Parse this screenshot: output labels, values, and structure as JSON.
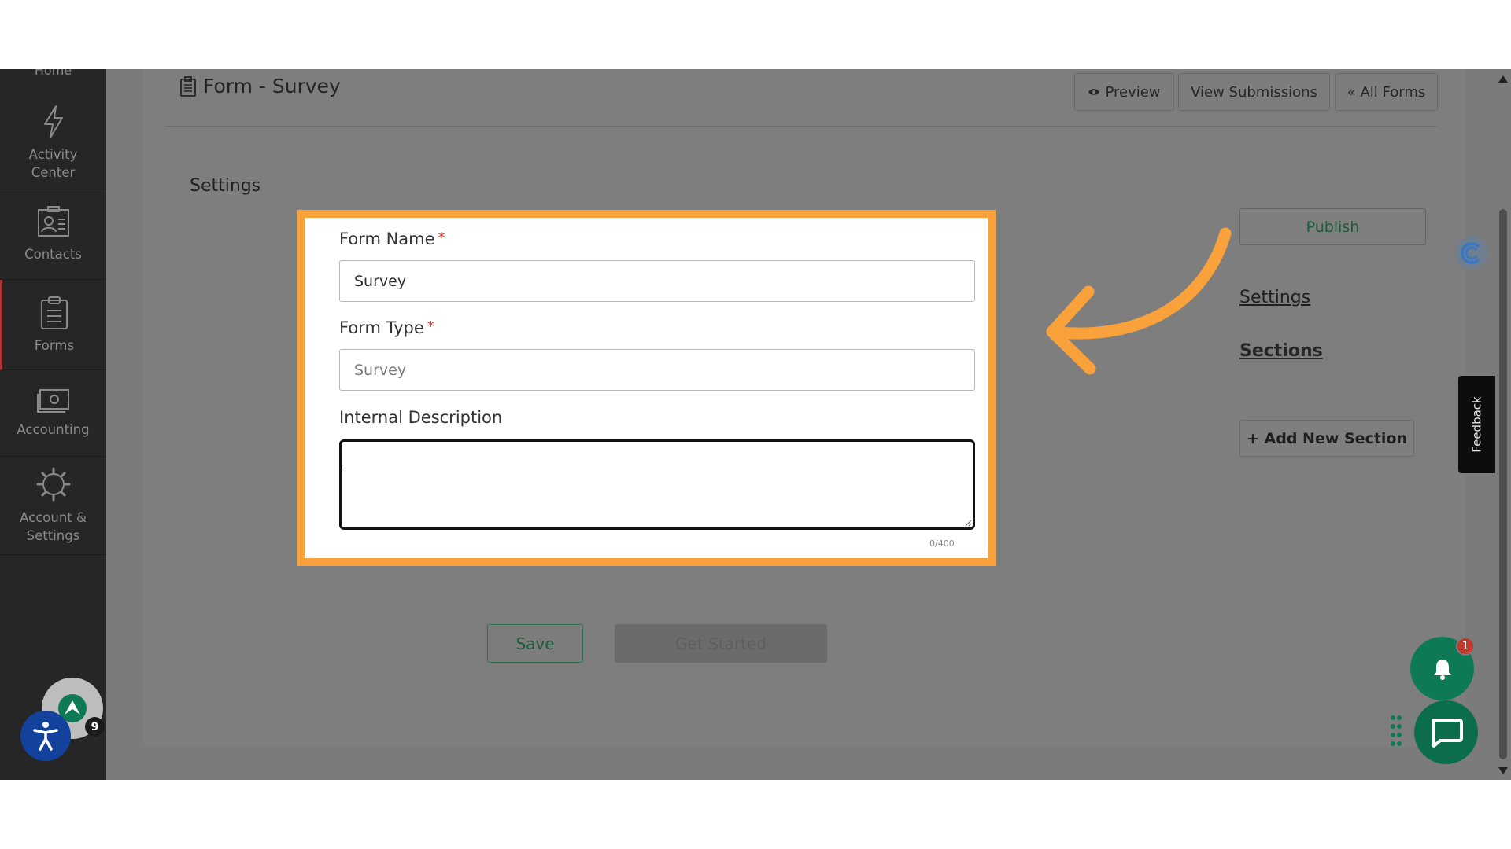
{
  "sidebar": {
    "items": [
      {
        "label": "Home",
        "icon": "home-icon"
      },
      {
        "label": "Activity Center",
        "label_lines": [
          "Activity",
          "Center"
        ],
        "icon": "lightning-icon"
      },
      {
        "label": "Contacts",
        "icon": "contact-card-icon"
      },
      {
        "label": "Forms",
        "icon": "clipboard-icon",
        "active": true
      },
      {
        "label": "Accounting",
        "icon": "cash-icon"
      },
      {
        "label": "Account & Settings",
        "label_lines": [
          "Account &",
          "Settings"
        ],
        "icon": "gear-icon"
      }
    ],
    "avatar_badge": "9"
  },
  "header": {
    "title": "Form - Survey",
    "preview_label": "Preview",
    "view_submissions_label": "View Submissions",
    "all_forms_label": "« All Forms"
  },
  "settings_heading": "Settings",
  "form": {
    "form_name_label": "Form Name",
    "form_name_value": "Survey",
    "form_type_label": "Form Type",
    "form_type_value": "Survey",
    "required_mark": "*",
    "description_label": "Internal Description",
    "description_value": "",
    "char_count": "0/400"
  },
  "right_panel": {
    "publish_label": "Publish",
    "settings_link": "Settings",
    "sections_link": "Sections",
    "add_section_label": "+ Add New Section"
  },
  "footer": {
    "save_label": "Save",
    "get_started_label": "Get Started"
  },
  "feedback_label": "Feedback",
  "notifications": {
    "badge": "1"
  },
  "colors": {
    "highlight": "#f9a13a",
    "overlay": "#7b7b7b",
    "sidebar": "#262626",
    "brand_green": "#0e7a55",
    "required": "#d93025"
  }
}
